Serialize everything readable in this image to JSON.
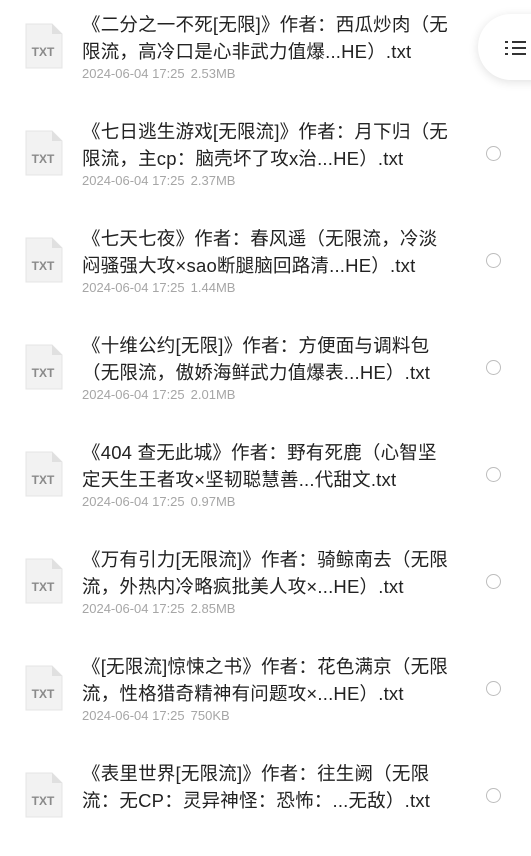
{
  "files": [
    {
      "title": "《二分之一不死[无限]》作者：西瓜炒肉（无限流，高冷口是心非武力值爆...HE）.txt",
      "date": "2024-06-04 17:25",
      "size": "2.53MB",
      "icon_label": "TXT"
    },
    {
      "title": "《七日逃生游戏[无限流]》作者：月下归（无限流，主cp：脑壳坏了攻x治...HE）.txt",
      "date": "2024-06-04 17:25",
      "size": "2.37MB",
      "icon_label": "TXT"
    },
    {
      "title": "《七天七夜》作者：春风遥（无限流，冷淡闷骚强大攻×sao断腿脑回路清...HE）.txt",
      "date": "2024-06-04 17:25",
      "size": "1.44MB",
      "icon_label": "TXT"
    },
    {
      "title": "《十维公约[无限]》作者：方便面与调料包（无限流，傲娇海鲜武力值爆表...HE）.txt",
      "date": "2024-06-04 17:25",
      "size": "2.01MB",
      "icon_label": "TXT"
    },
    {
      "title": "《404 查无此城》作者：野有死鹿（心智坚定天生王者攻×坚韧聪慧善...代甜文.txt",
      "date": "2024-06-04 17:25",
      "size": "0.97MB",
      "icon_label": "TXT"
    },
    {
      "title": "《万有引力[无限流]》作者：骑鲸南去（无限流，外热内冷略疯批美人攻×...HE）.txt",
      "date": "2024-06-04 17:25",
      "size": "2.85MB",
      "icon_label": "TXT"
    },
    {
      "title": "《[无限流]惊悚之书》作者：花色满京（无限流，性格猎奇精神有问题攻×...HE）.txt",
      "date": "2024-06-04 17:25",
      "size": "750KB",
      "icon_label": "TXT"
    },
    {
      "title": "《表里世界[无限流]》作者：往生阙（无限流：无CP：灵异神怪：恐怖：...无敌）.txt",
      "date": "",
      "size": "",
      "icon_label": "TXT"
    }
  ],
  "menu_button_icon": "menu-icon",
  "colors": {
    "title": "#222222",
    "meta": "#a6a6a6",
    "radio": "#bdbdbd",
    "icon_paper": "#f2f2f2",
    "icon_fold": "#e0e0e0",
    "icon_text": "#8a8a8a"
  }
}
